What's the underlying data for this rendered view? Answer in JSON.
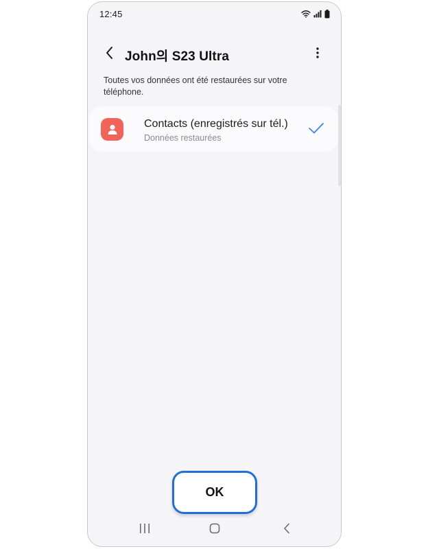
{
  "status_bar": {
    "time": "12:45",
    "icons": [
      "wifi-icon",
      "signal-icon",
      "battery-icon"
    ]
  },
  "header": {
    "title": "John의 S23 Ultra",
    "back_icon": "back-arrow-icon",
    "more_icon": "more-vertical-icon"
  },
  "description": "Toutes vos données ont été restaurées sur votre téléphone.",
  "items": [
    {
      "icon": "contacts-icon",
      "title": "Contacts (enregistrés sur tél.)",
      "subtitle": "Données restaurées",
      "status_icon": "check-icon"
    }
  ],
  "ok_button": {
    "label": "OK"
  },
  "nav_bar": {
    "icons": [
      "recents-icon",
      "home-icon",
      "back-icon"
    ]
  },
  "colors": {
    "background": "#f5f5f7",
    "card": "#fbfbfd",
    "accent": "#1e6fd9",
    "contacts_icon": "#f0645a",
    "check": "#3b82f6"
  }
}
